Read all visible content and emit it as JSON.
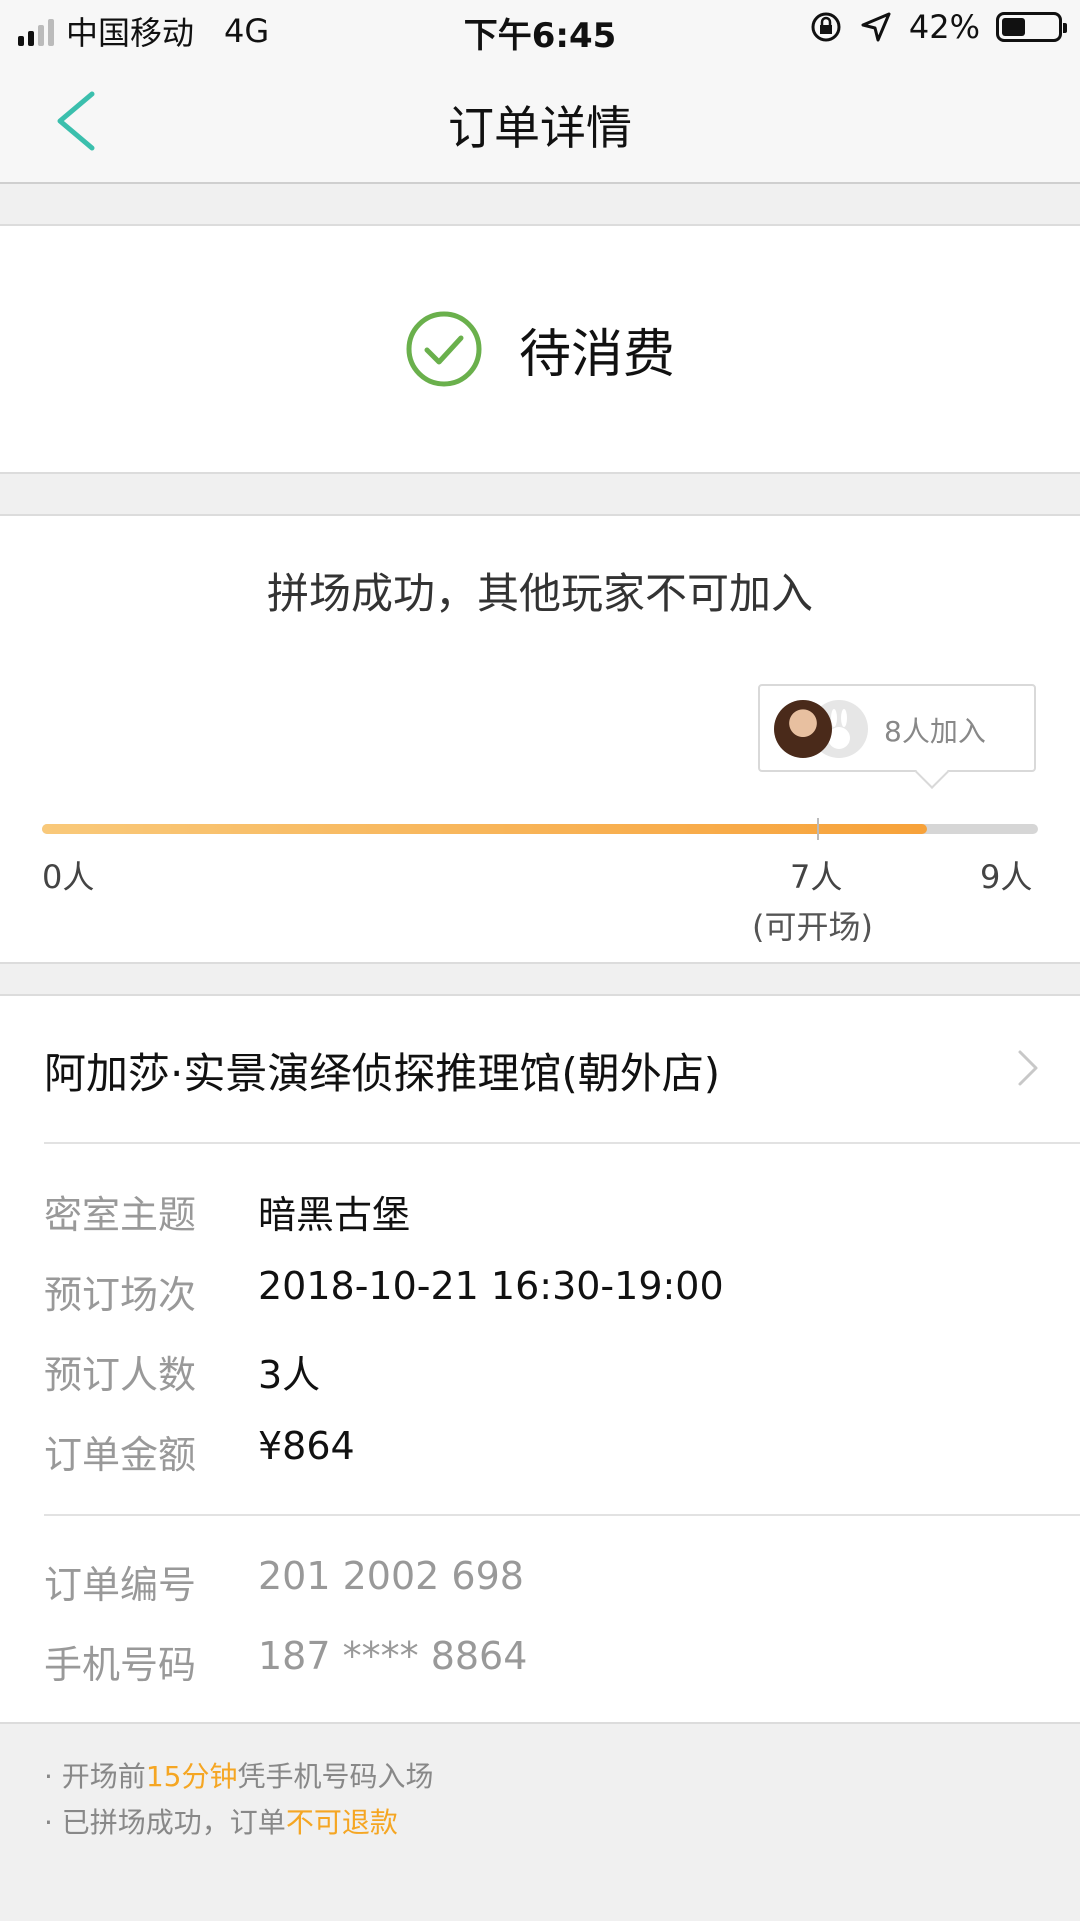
{
  "status_bar": {
    "carrier": "中国移动",
    "network": "4G",
    "time": "下午6:45",
    "battery": "42%"
  },
  "nav": {
    "title": "订单详情"
  },
  "order_status": {
    "text": "待消费",
    "color": "#6ab04c"
  },
  "group": {
    "title": "拼场成功，其他玩家不可加入",
    "joined_label": "8人加入",
    "min_label": "0人",
    "threshold_label": "7人",
    "threshold_note": "(可开场)",
    "max_label": "9人",
    "joined": 8,
    "max": 9,
    "threshold": 7
  },
  "store": {
    "name": "阿加莎·实景演绎侦探推理馆(朝外店)"
  },
  "details": [
    {
      "label": "密室主题",
      "value": "暗黑古堡"
    },
    {
      "label": "预订场次",
      "value": "2018-10-21 16:30-19:00"
    },
    {
      "label": "预订人数",
      "value": "3人"
    },
    {
      "label": "订单金额",
      "value": "¥864"
    }
  ],
  "meta": [
    {
      "label": "订单编号",
      "value": "201 2002 698"
    },
    {
      "label": "手机号码",
      "value": "187 **** 8864"
    }
  ],
  "notes": [
    {
      "prefix": "· 开场前",
      "highlight": "15分钟",
      "suffix": "凭手机号码入场"
    },
    {
      "prefix": "· 已拼场成功，订单",
      "highlight": "不可退款",
      "suffix": ""
    }
  ],
  "colors": {
    "accent_teal": "#3bbfad",
    "highlight_orange": "#f5a623"
  }
}
